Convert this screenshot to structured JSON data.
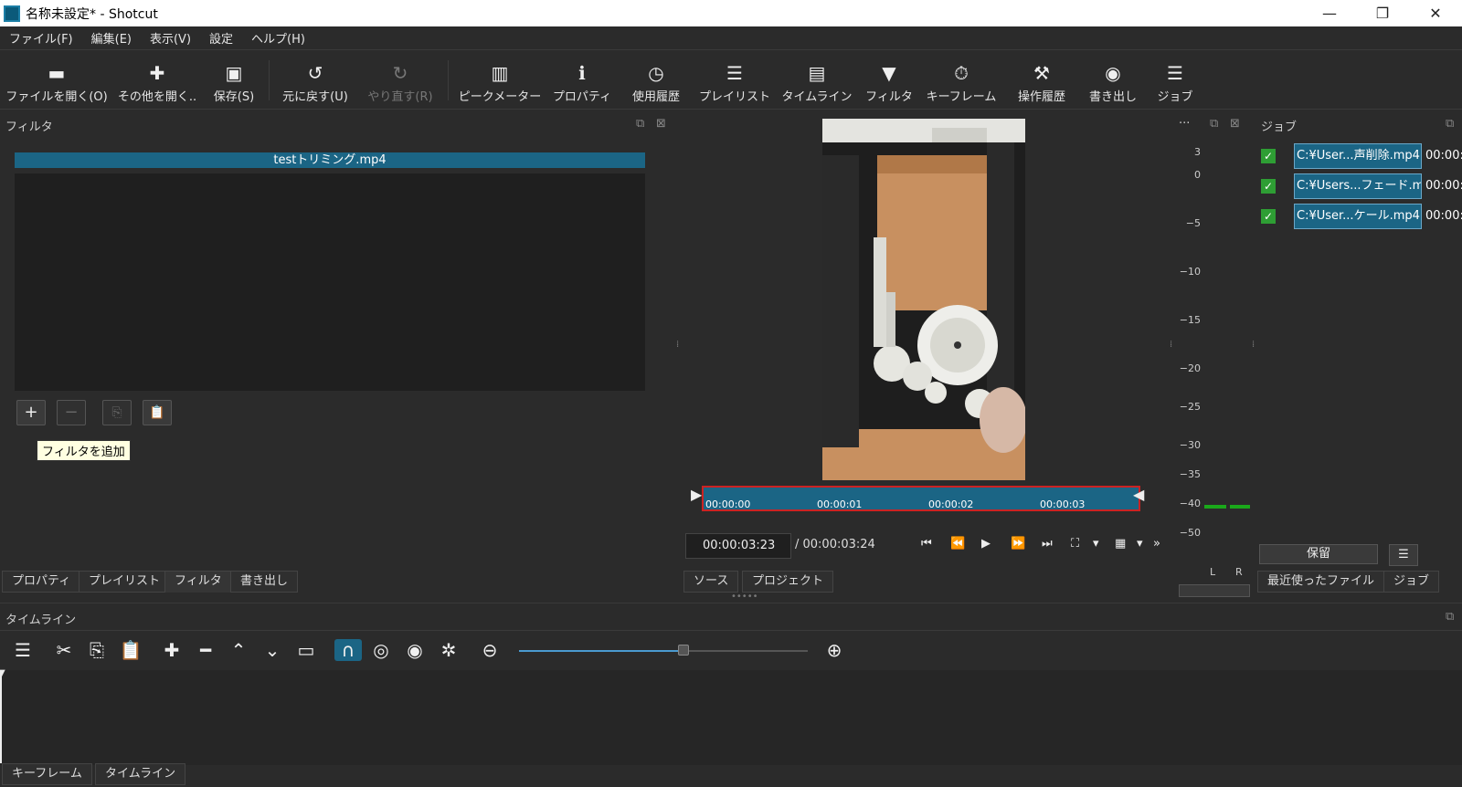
{
  "window": {
    "title": "名称未設定* - Shotcut",
    "minimize": "—",
    "restore": "❐",
    "close": "✕"
  },
  "menu": [
    "ファイル(F)",
    "編集(E)",
    "表示(V)",
    "設定",
    "ヘルプ(H)"
  ],
  "toolbar": [
    {
      "label": "ファイルを開く(O)",
      "icon": "folder-open-icon",
      "glyph": "▬"
    },
    {
      "label": "その他を開く..",
      "icon": "open-other-icon",
      "glyph": "✚"
    },
    {
      "label": "保存(S)",
      "icon": "save-icon",
      "glyph": "▣"
    },
    {
      "label": "元に戻す(U)",
      "icon": "undo-icon",
      "glyph": "↺"
    },
    {
      "label": "やり直す(R)",
      "icon": "redo-icon",
      "glyph": "↻"
    },
    {
      "label": "ピークメーター",
      "icon": "peak-meter-icon",
      "glyph": "▥"
    },
    {
      "label": "プロパティ",
      "icon": "info-icon",
      "glyph": "ℹ"
    },
    {
      "label": "使用履歴",
      "icon": "clock-icon",
      "glyph": "◷"
    },
    {
      "label": "プレイリスト",
      "icon": "list-icon",
      "glyph": "☰"
    },
    {
      "label": "タイムライン",
      "icon": "timeline-icon",
      "glyph": "▤"
    },
    {
      "label": "フィルタ",
      "icon": "funnel-icon",
      "glyph": "▼"
    },
    {
      "label": "キーフレーム",
      "icon": "stopwatch-icon",
      "glyph": "⏱"
    },
    {
      "label": "操作履歴",
      "icon": "history-icon",
      "glyph": "⚒"
    },
    {
      "label": "書き出し",
      "icon": "disc-icon",
      "glyph": "◉"
    },
    {
      "label": "ジョブ",
      "icon": "database-icon",
      "glyph": "☰"
    }
  ],
  "filters": {
    "panel_title": "フィルタ",
    "clip_name": "testトリミング.mp4",
    "add_tooltip": "フィルタを追加",
    "buttons": {
      "add": "+",
      "remove": "−",
      "copy": "⎘",
      "paste": "📋"
    }
  },
  "left_tabs": [
    "プロパティ",
    "プレイリスト",
    "フィルタ",
    "書き出し"
  ],
  "player": {
    "ticks": [
      "00:00:00",
      "00:00:01",
      "00:00:02",
      "00:00:03"
    ],
    "position": "00:00:03:23",
    "duration": "/ 00:00:03:24",
    "tabs": [
      "ソース",
      "プロジェクト"
    ],
    "more": "···",
    "controls": [
      "⏮",
      "⏪",
      "▶",
      "⏩",
      "⏭",
      "⛶",
      "▾",
      "▦",
      "▾",
      "»"
    ]
  },
  "meter": {
    "labels": [
      "3",
      "0",
      "−5",
      "−10",
      "−15",
      "−20",
      "−25",
      "−30",
      "−35",
      "−40",
      "−50"
    ],
    "L": "L",
    "R": "R"
  },
  "jobs": {
    "title": "ジョブ",
    "items": [
      {
        "name": "C:¥User...声削除.mp4",
        "time": "00:00:"
      },
      {
        "name": "C:¥Users...フェード.mp4",
        "time": "00:00:"
      },
      {
        "name": "C:¥User...ケール.mp4",
        "time": "00:00:"
      }
    ],
    "hold_button": "保留",
    "menu_button": "☰",
    "tabs": [
      "最近使ったファイル",
      "ジョブ"
    ]
  },
  "timeline": {
    "title": "タイムライン",
    "tools": [
      "☰",
      "✂",
      "⎘",
      "📋",
      "✚",
      "━",
      "⌃",
      "⌄",
      "▭",
      "∩",
      "◎",
      "◉",
      "✲",
      "⊖",
      "⊕"
    ],
    "bottom_tabs": [
      "キーフレーム",
      "タイムライン"
    ],
    "zoom_level": 0.57
  },
  "colors": {
    "accent": "#1b6585",
    "playhead": "#cc2222",
    "meter_green": "#1aa81a",
    "check": "#2e9e34"
  }
}
